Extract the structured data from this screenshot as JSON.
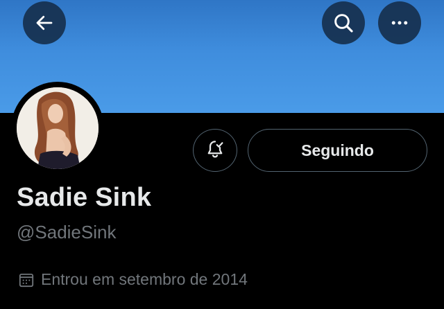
{
  "header": {
    "back_icon": "arrow-left-icon",
    "search_icon": "search-icon",
    "more_icon": "more-horizontal-icon",
    "banner_color": "#3f8ddd",
    "button_bg": "#16304e"
  },
  "profile": {
    "avatar_icon": "profile-photo",
    "notify_icon": "bell-check-icon",
    "following_label": "Seguindo",
    "display_name": "Sadie Sink",
    "handle": "@SadieSink",
    "calendar_icon": "calendar-icon",
    "joined": "Entrou em setembro de 2014"
  },
  "colors": {
    "background": "#000000",
    "text_primary": "#e7e9ea",
    "text_secondary": "#71767b",
    "border": "#536471"
  }
}
